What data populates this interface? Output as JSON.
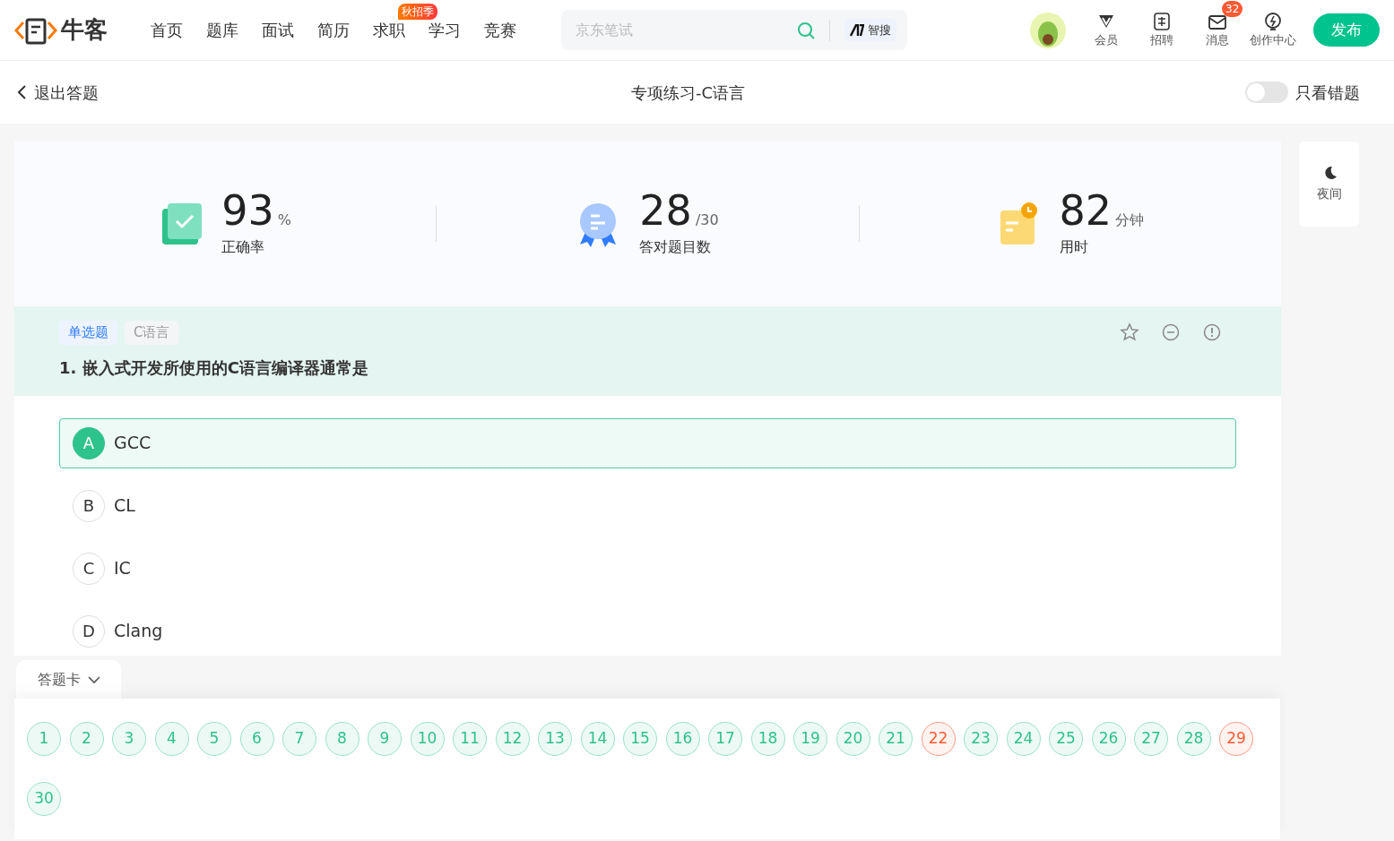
{
  "header": {
    "logo_text": "牛客",
    "nav": [
      {
        "label": "首页"
      },
      {
        "label": "题库"
      },
      {
        "label": "面试"
      },
      {
        "label": "简历"
      },
      {
        "label": "求职",
        "badge": "秋招季"
      },
      {
        "label": "学习"
      },
      {
        "label": "竞赛"
      }
    ],
    "search": {
      "placeholder": "京东笔试",
      "ai_button": "智搜"
    },
    "tools": [
      {
        "kind": "vip",
        "label": "会员"
      },
      {
        "kind": "jobs",
        "label": "招聘"
      },
      {
        "kind": "mail",
        "label": "消息",
        "count": "32"
      },
      {
        "kind": "bulb",
        "label": "创作中心"
      }
    ],
    "publish_button": "发布"
  },
  "subheader": {
    "back": "退出答题",
    "title": "专项练习-C语言",
    "toggle": {
      "label": "只看错题",
      "on": false
    }
  },
  "stats": [
    {
      "kind": "accuracy",
      "value": "93",
      "unit": "%",
      "label": "正确率"
    },
    {
      "kind": "correct",
      "value": "28",
      "unit": "/30",
      "label": "答对题目数"
    },
    {
      "kind": "time",
      "value": "82",
      "unit": "分钟",
      "label": "用时"
    }
  ],
  "question": {
    "tags": [
      {
        "label": "单选题",
        "kind": "type"
      },
      {
        "label": "C语言",
        "kind": "topic"
      }
    ],
    "title": "1. 嵌入式开发所使用的C语言编译器通常是",
    "options": [
      {
        "letter": "A",
        "text": "GCC",
        "selected": true
      },
      {
        "letter": "B",
        "text": "CL",
        "selected": false
      },
      {
        "letter": "C",
        "text": "IC",
        "selected": false
      },
      {
        "letter": "D",
        "text": "Clang",
        "selected": false
      }
    ]
  },
  "night_button": "夜间",
  "answer_card": {
    "title": "答题卡",
    "expanded": true,
    "items": [
      {
        "label": "1",
        "wrong": false
      },
      {
        "label": "2",
        "wrong": false
      },
      {
        "label": "3",
        "wrong": false
      },
      {
        "label": "4",
        "wrong": false
      },
      {
        "label": "5",
        "wrong": false
      },
      {
        "label": "6",
        "wrong": false
      },
      {
        "label": "7",
        "wrong": false
      },
      {
        "label": "8",
        "wrong": false
      },
      {
        "label": "9",
        "wrong": false
      },
      {
        "label": "10",
        "wrong": false
      },
      {
        "label": "11",
        "wrong": false
      },
      {
        "label": "12",
        "wrong": false
      },
      {
        "label": "13",
        "wrong": false
      },
      {
        "label": "14",
        "wrong": false
      },
      {
        "label": "15",
        "wrong": false
      },
      {
        "label": "16",
        "wrong": false
      },
      {
        "label": "17",
        "wrong": false
      },
      {
        "label": "18",
        "wrong": false
      },
      {
        "label": "19",
        "wrong": false
      },
      {
        "label": "20",
        "wrong": false
      },
      {
        "label": "21",
        "wrong": false
      },
      {
        "label": "22",
        "wrong": true
      },
      {
        "label": "23",
        "wrong": false
      },
      {
        "label": "24",
        "wrong": false
      },
      {
        "label": "25",
        "wrong": false
      },
      {
        "label": "26",
        "wrong": false
      },
      {
        "label": "27",
        "wrong": false
      },
      {
        "label": "28",
        "wrong": false
      },
      {
        "label": "29",
        "wrong": true
      },
      {
        "label": "30",
        "wrong": false
      }
    ]
  }
}
